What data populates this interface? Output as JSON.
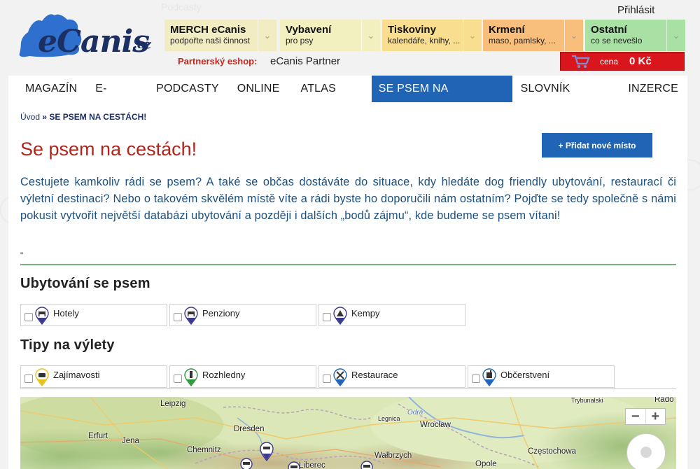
{
  "header": {
    "podcast_ghost": "Podcasty",
    "login": "Přihlásit",
    "logo_text": "eCanis",
    "logo_tld": ".cz",
    "categories": [
      {
        "title": "MERCH eCanis",
        "subtitle": "podpořte naši činnost"
      },
      {
        "title": "Vybavení",
        "subtitle": "pro psy"
      },
      {
        "title": "Tiskoviny",
        "subtitle": "kalendáře, knihy, ..."
      },
      {
        "title": "Krmení",
        "subtitle": "maso, pamlsky, ..."
      },
      {
        "title": "Ostatní",
        "subtitle": "co se nevešlo"
      }
    ],
    "partner_label": "Partnerský eshop:",
    "partner_value": "eCanis Partner",
    "cart_label": "cena",
    "cart_value": "0 Kč",
    "colors": {
      "accent_red": "#d9161b",
      "nav_active": "#1f64b5",
      "brand_navy": "#1c2f63"
    }
  },
  "nav": {
    "items": [
      "MAGAZÍN",
      "E-SHOP",
      "PODCASTY",
      "ONLINE",
      "ATLAS PSŮ",
      "SE PSEM NA CESTÁCH!",
      "SLOVNÍK POJMŮ",
      "INZERCE"
    ],
    "active": "SE PSEM NA CESTÁCH!"
  },
  "page": {
    "breadcrumb_home": "Úvod",
    "breadcrumb_sep": "»",
    "breadcrumb_current": "SE PSEM NA CESTÁCH!",
    "title": "Se psem na cestách!",
    "add_button": "+ Přidat nové místo",
    "intro": "Cestujete kamkoliv rádi se psem? A také se občas dostáváte do situace, kdy hledáte dog friendly ubytování, restaurací či výletní destinaci? Nebo o takovém skvělém místě víte a rádi byste ho doporučili nám ostatním? Pojďte se tedy společně s námi pokusit vytvořit největší databázi ubytování a později i dalších „bodů zájmu“, kde budeme se psem vítani!",
    "quote_mark": "\""
  },
  "accommodation": {
    "heading": "Ubytování se psem",
    "filters": [
      {
        "label": "Hotely",
        "icon": "hotel-pin-icon",
        "color": "#3b3a8c"
      },
      {
        "label": "Penziony",
        "icon": "pension-pin-icon",
        "color": "#3b3a8c"
      },
      {
        "label": "Kempy",
        "icon": "camp-pin-icon",
        "color": "#3b3a8c"
      }
    ]
  },
  "trips": {
    "heading": "Tipy na výlety",
    "filters": [
      {
        "label": "Zajímavosti",
        "icon": "attraction-pin-icon",
        "color": "#e6c21b"
      },
      {
        "label": "Rozhledny",
        "icon": "lookout-pin-icon",
        "color": "#2e9a3a"
      },
      {
        "label": "Restaurace",
        "icon": "restaurant-pin-icon",
        "color": "#1f64b5"
      },
      {
        "label": "Občerstvení",
        "icon": "snack-pin-icon",
        "color": "#1f64b5"
      }
    ]
  },
  "map": {
    "labels": [
      "Leipzig",
      "Dresden",
      "Erfurt",
      "Jena",
      "Chemnitz",
      "Legnica",
      "Odra",
      "Wrocław",
      "Wałbrzych",
      "Liberec",
      "Opole",
      "Częstochowa",
      "Trybunalski",
      "Rado"
    ],
    "zoom_in": "+",
    "zoom_out": "−"
  }
}
